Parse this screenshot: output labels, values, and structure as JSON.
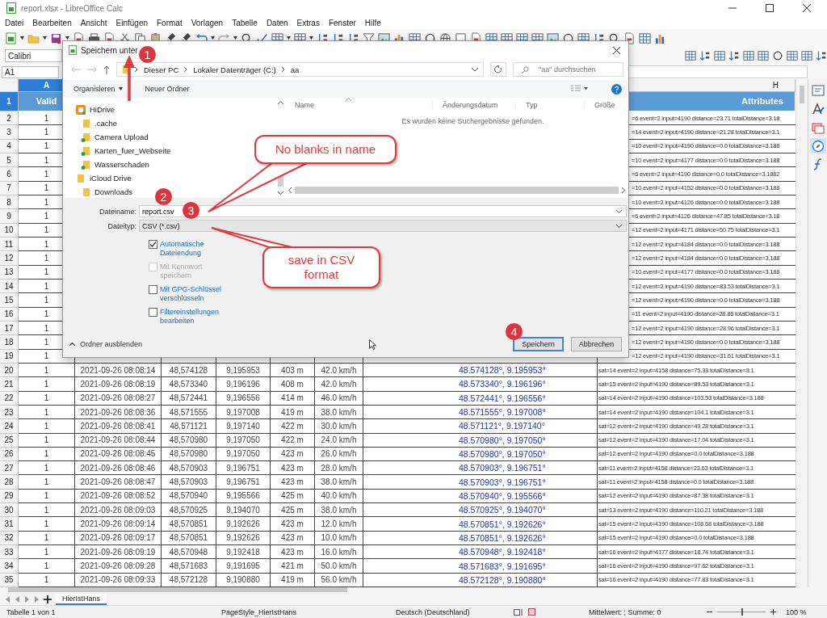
{
  "window": {
    "title": "report.xlsx - LibreOffice Calc"
  },
  "menu": [
    "Datei",
    "Bearbeiten",
    "Ansicht",
    "Einfügen",
    "Format",
    "Vorlagen",
    "Tabelle",
    "Daten",
    "Extras",
    "Fenster",
    "Hilfe"
  ],
  "font_box": {
    "value": "Calibri"
  },
  "name_box": {
    "value": "A1"
  },
  "column_a_header": {
    "label": "A",
    "selected": true
  },
  "column_h_header": {
    "label": "H",
    "selected": false
  },
  "rows": [
    {
      "number": "1",
      "selected": true,
      "kind": "header",
      "valid": "Valid",
      "attributes": "Attributes"
    },
    {
      "number": "2",
      "selected": false,
      "kind": "data",
      "valid": "1",
      "attributes": "=6 event=2 input=4190 distance=23.71 totalDistance=3.18"
    },
    {
      "number": "3",
      "selected": false,
      "kind": "data",
      "valid": "1",
      "attributes": "=14 event=2 input=4190 distance=21.28 totalDistance=3.1"
    },
    {
      "number": "4",
      "selected": false,
      "kind": "data",
      "valid": "1",
      "attributes": "=10 event=2 input=4190 distance=0.0 totalDistance=3.188"
    },
    {
      "number": "5",
      "selected": false,
      "kind": "data",
      "valid": "1",
      "attributes": "=10 event=2 input=4177 distance=0.0 totalDistance=3.188"
    },
    {
      "number": "6",
      "selected": false,
      "kind": "data",
      "valid": "1",
      "attributes": "=6 event=2 input=4190 distance=0.0 totalDistance=3.1882"
    },
    {
      "number": "7",
      "selected": false,
      "kind": "data",
      "valid": "1",
      "attributes": "=10 event=2 input=4152 distance=0.0 totalDistance=3.188"
    },
    {
      "number": "8",
      "selected": false,
      "kind": "data",
      "valid": "1",
      "attributes": "=10 event=2 input=4126 distance=0.0 totalDistance=3.188"
    },
    {
      "number": "9",
      "selected": false,
      "kind": "data",
      "valid": "1",
      "attributes": "=6 event=2 input=4126 distance=47.85 totalDistance=3.18"
    },
    {
      "number": "10",
      "selected": false,
      "kind": "data",
      "valid": "1",
      "attributes": "=12 event=2 input=4171 distance=50.75 totalDistance=3.1"
    },
    {
      "number": "11",
      "selected": false,
      "kind": "data",
      "valid": "1",
      "attributes": "=12 event=2 input=4184 distance=0.0 totalDistance=3.188"
    },
    {
      "number": "12",
      "selected": false,
      "kind": "data",
      "valid": "1",
      "attributes": "=12 event=2 input=4184 distance=0.0 totalDistance=3.188"
    },
    {
      "number": "13",
      "selected": false,
      "kind": "data",
      "valid": "1",
      "attributes": "=10 event=2 input=4177 distance=0.0 totalDistance=3.188"
    },
    {
      "number": "14",
      "selected": false,
      "kind": "data",
      "valid": "1",
      "attributes": "=12 event=2 input=4190 distance=83.53 totalDistance=3.1"
    },
    {
      "number": "15",
      "selected": false,
      "kind": "data",
      "valid": "1",
      "attributes": "=12 event=2 input=4190 distance=0.0 totalDistance=3.188"
    },
    {
      "number": "16",
      "selected": false,
      "kind": "data",
      "valid": "1",
      "attributes": "=11 event=2 input=4190 distance=28.86 totalDistance=3.1"
    },
    {
      "number": "17",
      "selected": false,
      "kind": "data",
      "valid": "1",
      "attributes": "=12 event=2 input=4190 distance=28.96 totalDistance=3.1"
    },
    {
      "number": "18",
      "selected": false,
      "kind": "data",
      "valid": "1",
      "attributes": "=12 event=2 input=4190 distance=0.0 totalDistance=3.188"
    },
    {
      "number": "19",
      "selected": false,
      "kind": "data",
      "valid": "1",
      "attributes": "=12 event=2 input=4190 distance=31.61 totalDistance=3.1"
    },
    {
      "number": "20",
      "selected": false,
      "kind": "data",
      "valid": "1",
      "time": "2021-09-26 08:08:14",
      "lat": "48,574128",
      "lon": "9,195953",
      "altitude": "403 m",
      "speed": "42.0 km/h",
      "position": "48.574128°, 9.195953°",
      "attributes": "sat=14 event=2 input=4158 distance=75.33 totalDistance=3.1"
    },
    {
      "number": "21",
      "selected": false,
      "kind": "data",
      "valid": "1",
      "time": "2021-09-26 08:08:19",
      "lat": "48,573340",
      "lon": "9,196196",
      "altitude": "408 m",
      "speed": "42.0 km/h",
      "position": "48.573340°, 9.196196°",
      "attributes": "sat=15 event=2 input=4190 distance=89.53 totalDistance=3.1"
    },
    {
      "number": "22",
      "selected": false,
      "kind": "data",
      "valid": "1",
      "time": "2021-09-26 08:08:27",
      "lat": "48,572441",
      "lon": "9,196556",
      "altitude": "414 m",
      "speed": "46.0 km/h",
      "position": "48.572441°, 9.196556°",
      "attributes": "sat=14 event=2 input=4190 distance=103.53 totalDistance=3.188"
    },
    {
      "number": "23",
      "selected": false,
      "kind": "data",
      "valid": "1",
      "time": "2021-09-26 08:08:36",
      "lat": "48,571555",
      "lon": "9,197008",
      "altitude": "419 m",
      "speed": "38.0 km/h",
      "position": "48.571555°, 9.197008°",
      "attributes": "sat=14 event=2 input=4190 distance=104.1 totalDistance=3.1"
    },
    {
      "number": "24",
      "selected": false,
      "kind": "data",
      "valid": "1",
      "time": "2021-09-26 08:08:41",
      "lat": "48,571121",
      "lon": "9,197140",
      "altitude": "422 m",
      "speed": "30.0 km/h",
      "position": "48.571121°, 9.197140°",
      "attributes": "sat=12 event=2 input=4190 distance=49.28 totalDistance=3.1"
    },
    {
      "number": "25",
      "selected": false,
      "kind": "data",
      "valid": "1",
      "time": "2021-09-26 08:08:44",
      "lat": "48,570980",
      "lon": "9,197050",
      "altitude": "422 m",
      "speed": "24.0 km/h",
      "position": "48.570980°, 9.197050°",
      "attributes": "sat=12 event=2 input=4190 distance=17.04 totalDistance=3.1"
    },
    {
      "number": "26",
      "selected": false,
      "kind": "data",
      "valid": "1",
      "time": "2021-09-26 08:08:45",
      "lat": "48,570980",
      "lon": "9,197050",
      "altitude": "423 m",
      "speed": "26.0 km/h",
      "position": "48.570980°, 9.197050°",
      "attributes": "sat=12 event=2 input=4190 distance=0.0 totalDistance=3.188"
    },
    {
      "number": "27",
      "selected": false,
      "kind": "data",
      "valid": "1",
      "time": "2021-09-26 08:08:46",
      "lat": "48,570903",
      "lon": "9,196751",
      "altitude": "423 m",
      "speed": "28.0 km/h",
      "position": "48.570903°, 9.196751°",
      "attributes": "sat=11 event=2 input=4158 distance=23.63 totalDistance=3.1"
    },
    {
      "number": "28",
      "selected": false,
      "kind": "data",
      "valid": "1",
      "time": "2021-09-26 08:08:47",
      "lat": "48,570903",
      "lon": "9,196751",
      "altitude": "423 m",
      "speed": "38.0 km/h",
      "position": "48.570903°, 9.196751°",
      "attributes": "sat=11 event=2 input=4158 distance=0.0 totalDistance=3.188"
    },
    {
      "number": "29",
      "selected": false,
      "kind": "data",
      "valid": "1",
      "time": "2021-09-26 08:08:52",
      "lat": "48,570940",
      "lon": "9,195566",
      "altitude": "425 m",
      "speed": "40.0 km/h",
      "position": "48.570940°, 9.195566°",
      "attributes": "sat=12 event=2 input=4190 distance=87.38 totalDistance=3.1"
    },
    {
      "number": "30",
      "selected": false,
      "kind": "data",
      "valid": "1",
      "time": "2021-09-26 08:09:03",
      "lat": "48,570925",
      "lon": "9,194070",
      "altitude": "425 m",
      "speed": "38.0 km/h",
      "position": "48.570925°, 9.194070°",
      "attributes": "sat=13 event=2 input=4190 distance=110.21 totalDistance=3.188"
    },
    {
      "number": "31",
      "selected": false,
      "kind": "data",
      "valid": "1",
      "time": "2021-09-26 08:09:14",
      "lat": "48,570851",
      "lon": "9,192626",
      "altitude": "423 m",
      "speed": "12.0 km/h",
      "position": "48.570851°, 9.192626°",
      "attributes": "sat=15 event=2 input=4190 distance=106.68 totalDistance=3.188"
    },
    {
      "number": "32",
      "selected": false,
      "kind": "data",
      "valid": "1",
      "time": "2021-09-26 08:09:17",
      "lat": "48,570851",
      "lon": "9,192626",
      "altitude": "423 m",
      "speed": "10.0 km/h",
      "position": "48.570851°, 9.192626°",
      "attributes": "sat=15 event=2 input=4190 distance=0.0 totalDistance=3.188"
    },
    {
      "number": "33",
      "selected": false,
      "kind": "data",
      "valid": "1",
      "time": "2021-09-26 08:09:19",
      "lat": "48,570948",
      "lon": "9,192418",
      "altitude": "423 m",
      "speed": "16.0 km/h",
      "position": "48.570948°, 9.192418°",
      "attributes": "sat=16 event=2 input=4177 distance=18.74 totalDistance=3.1"
    },
    {
      "number": "34",
      "selected": false,
      "kind": "data",
      "valid": "1",
      "time": "2021-09-26 08:09:28",
      "lat": "48,571683",
      "lon": "9,191695",
      "altitude": "421 m",
      "speed": "50.0 km/h",
      "position": "48.571683°, 9.191695°",
      "attributes": "sat=16 event=2 input=4190 distance=97.62 totalDistance=3.1"
    },
    {
      "number": "35",
      "selected": false,
      "kind": "data",
      "valid": "1",
      "time": "2021-09-26 08:09:33",
      "lat": "48,572128",
      "lon": "9,190880",
      "altitude": "419 m",
      "speed": "56.0 km/h",
      "position": "48.572128°, 9.190880°",
      "attributes": "sat=16 event=2 input=4190 distance=77.83 totalDistance=3.1"
    }
  ],
  "sheet_tabs": [
    {
      "label": "HierIstHans",
      "selected": true
    }
  ],
  "status_bar": {
    "sheet": "Tabelle 1 von 1",
    "page_style": "PageStyle_HierIstHans",
    "language": "Deutsch (Deutschland)",
    "summary": "Mittelwert: ; Summe: 0",
    "zoom": "100 %",
    "zoom_slider": {
      "level": 0.5
    }
  },
  "dialog": {
    "title": "Speichern unter",
    "breadcrumb": [
      "Dieser PC",
      "Lokaler Datenträger (C:)",
      "aa"
    ],
    "search": {
      "placeholder": "\"aa\" durchsuchen"
    },
    "toolbar": [
      "Organisieren",
      "Neuer Ordner"
    ],
    "nav_tree": [
      {
        "label": "HiDrive",
        "kind": "drive",
        "children": [
          {
            "label": ".cache",
            "kind": "folder"
          },
          {
            "label": "Camera Upload",
            "kind": "synced"
          },
          {
            "label": "Karten_fuer_Webseite",
            "kind": "synced"
          },
          {
            "label": "Wasserschaden",
            "kind": "synced"
          }
        ]
      },
      {
        "label": "iCloud Drive",
        "kind": "folder",
        "children": [
          {
            "label": "Downloads",
            "kind": "folder"
          }
        ]
      }
    ],
    "columns": [
      "Name",
      "Änderungsdatum",
      "Typ",
      "Größe"
    ],
    "empty_message": "Es wurden keine Suchergebnisse gefunden.",
    "file_name": {
      "label": "Dateiname:",
      "value": "report.csv"
    },
    "file_type": {
      "label": "Dateityp:",
      "value": "CSV (*.csv)"
    },
    "options": [
      {
        "label": "Automatische Dateiendung",
        "checked": true,
        "disabled": false
      },
      {
        "label": "Mit Kennwort speichern",
        "checked": false,
        "disabled": true
      },
      {
        "label": "Mit GPG-Schlüssel verschlüsseln",
        "checked": false,
        "disabled": false
      },
      {
        "label": "Filtereinstellungen bearbeiten",
        "checked": false,
        "disabled": false
      }
    ],
    "hide_folders": "Ordner ausblenden",
    "buttons": [
      {
        "label": "Speichern",
        "default": true
      },
      {
        "label": "Abbrechen",
        "default": false
      }
    ]
  },
  "annotations": {
    "badges": [
      "1",
      "2",
      "3",
      "4"
    ],
    "callouts": [
      "No blanks in name",
      "save in CSV format"
    ]
  }
}
